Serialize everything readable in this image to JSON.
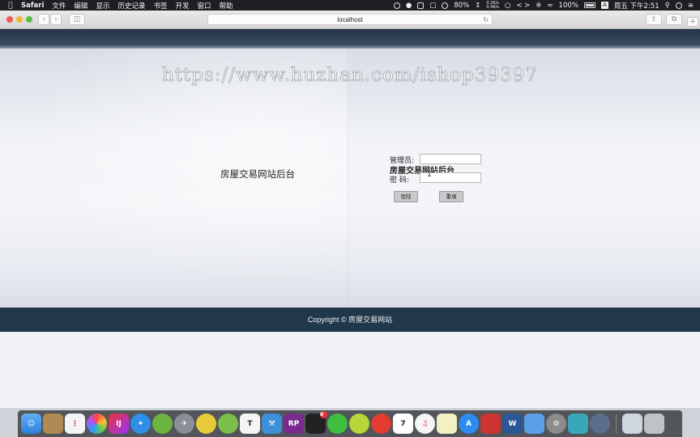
{
  "menubar": {
    "app_name": "Safari",
    "menus": [
      "文件",
      "编辑",
      "显示",
      "历史记录",
      "书签",
      "开发",
      "窗口",
      "帮助"
    ],
    "battery_percent_1": "80%",
    "net_up": "0.2K/s",
    "net_down": "0.4K/s",
    "battery_percent_2": "100%",
    "input_method": "A",
    "clock": "周五 下午2:51"
  },
  "browser": {
    "url": "localhost"
  },
  "page": {
    "watermark": "https://www.huzhan.com/ishop39397",
    "left_title": "房屋交易网站后台",
    "form": {
      "title": "房屋交易网站后台",
      "username_label": "管理员:",
      "password_label": "密   码:",
      "username_value": "",
      "password_value": "",
      "login_button": "登陆",
      "reset_button": "重填"
    },
    "footer": "Copyright © 房屋交易网站"
  },
  "dock": {
    "apps": [
      "finder-icon",
      "notes-icon",
      "reminders-icon",
      "photos-icon",
      "intellij-icon",
      "safari-icon",
      "spring-icon",
      "launchpad-icon",
      "lemon-icon",
      "android-studio-icon",
      "typora-icon",
      "xcode-icon",
      "axure-rp-icon",
      "qq-icon",
      "wechat-icon",
      "lime-icon",
      "netease-music-icon",
      "calendar-icon",
      "itunes-icon",
      "stickies-icon",
      "app-store-icon",
      "remote-desktop-icon",
      "word-icon",
      "keynote-icon",
      "system-preferences-icon",
      "navicat-icon",
      "chrome-icon",
      "preview-icon",
      "trash-icon"
    ],
    "qq_badge": "8",
    "calendar_day": "7",
    "axure_label": "RP",
    "intellij_label": "IJ",
    "typora_label": "T",
    "word_label": "W"
  },
  "colors": {
    "footer_bg": "#21374a",
    "top_band": "#243445",
    "menubar_bg": "#1d1f22"
  }
}
